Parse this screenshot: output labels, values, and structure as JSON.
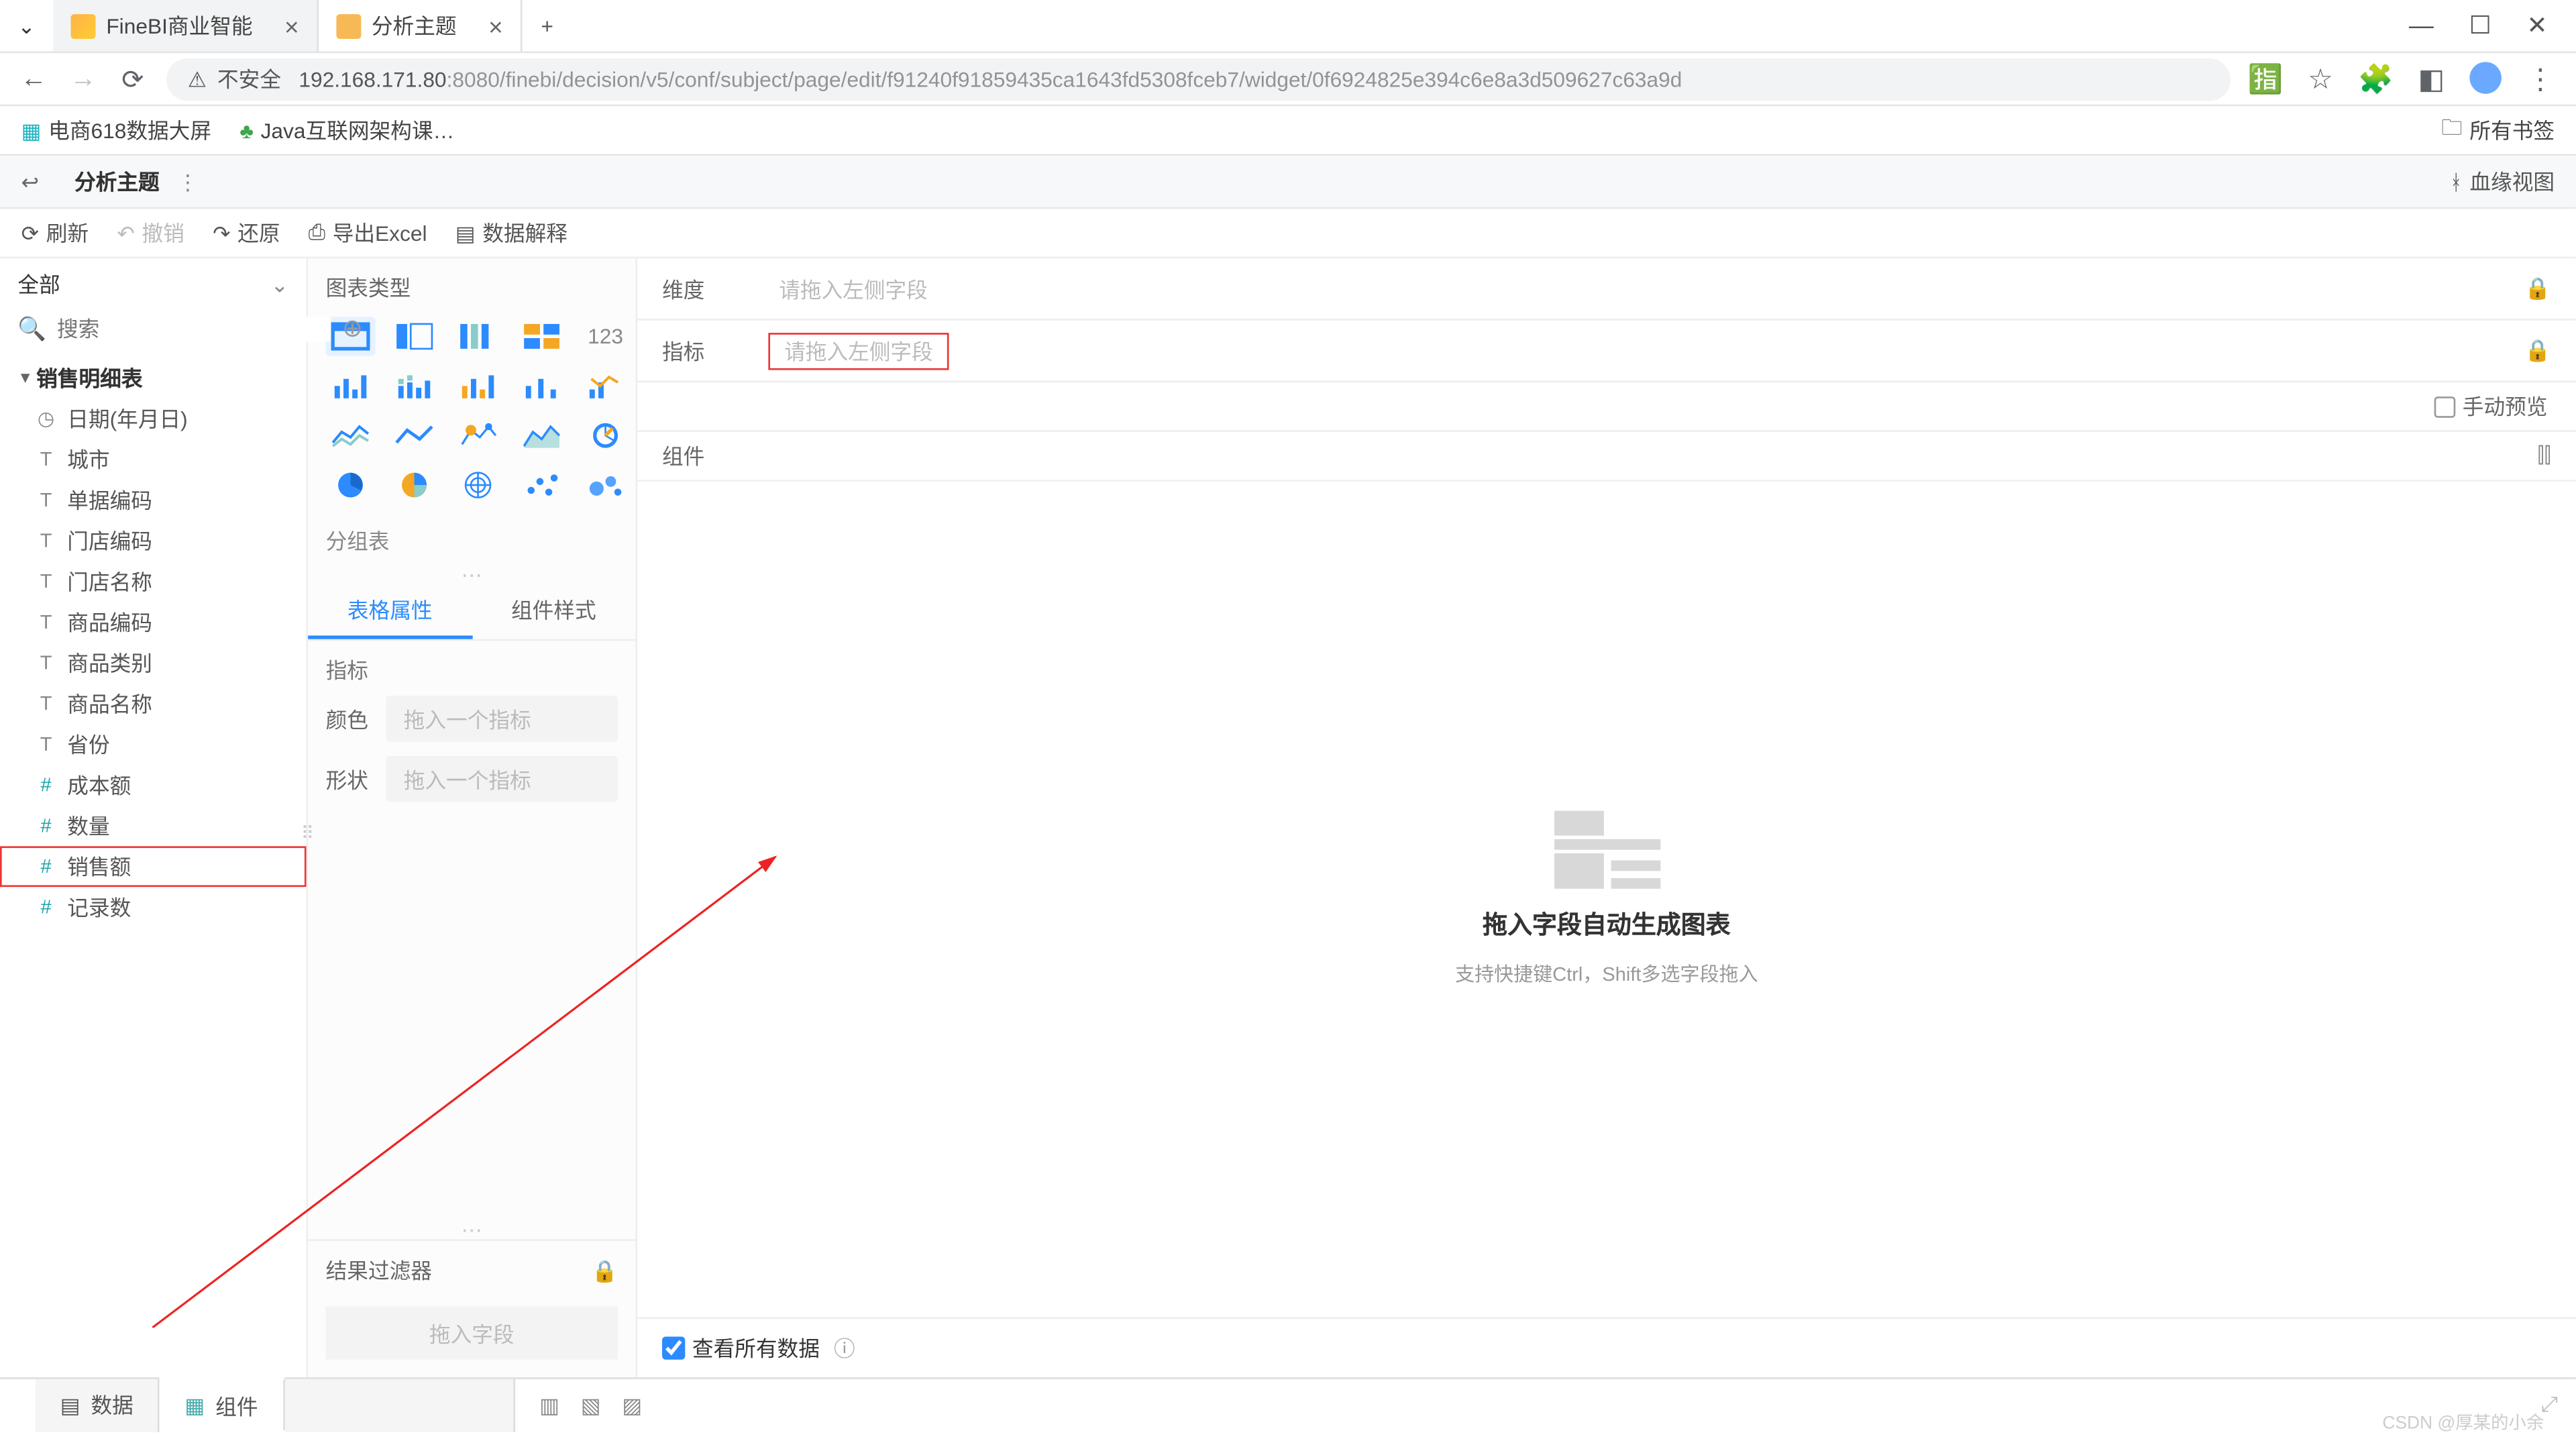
{
  "browser": {
    "tabs": [
      {
        "title": "FineBI商业智能"
      },
      {
        "title": "分析主题"
      }
    ],
    "url_prefix": "192.168.171.80",
    "url_rest": ":8080/finebi/decision/v5/conf/subject/page/edit/f91240f91859435ca1643fd5308fceb7/widget/0f6924825e394c6e8a3d509627c63a9d",
    "insecure": "不安全",
    "bookmarks": [
      {
        "label": "电商618数据大屏"
      },
      {
        "label": "Java互联网架构课…"
      }
    ],
    "all_bookmarks": "所有书签"
  },
  "appbar": {
    "title": "分析主题",
    "right": "血缘视图"
  },
  "toolbar": {
    "refresh": "刷新",
    "undo": "撤销",
    "redo": "还原",
    "export": "导出Excel",
    "explain": "数据解释"
  },
  "sidebar": {
    "all": "全部",
    "search_placeholder": "搜索",
    "group": "销售明细表",
    "fields": [
      {
        "ico": "clock",
        "name": "日期(年月日)"
      },
      {
        "ico": "text",
        "name": "城市"
      },
      {
        "ico": "text",
        "name": "单据编码"
      },
      {
        "ico": "text",
        "name": "门店编码"
      },
      {
        "ico": "text",
        "name": "门店名称"
      },
      {
        "ico": "text",
        "name": "商品编码"
      },
      {
        "ico": "text",
        "name": "商品类别"
      },
      {
        "ico": "text",
        "name": "商品名称"
      },
      {
        "ico": "text",
        "name": "省份"
      },
      {
        "ico": "hash",
        "name": "成本额"
      },
      {
        "ico": "hash",
        "name": "数量"
      },
      {
        "ico": "hash",
        "name": "销售额",
        "hi": true
      },
      {
        "ico": "hash",
        "name": "记录数"
      }
    ]
  },
  "mid": {
    "chart_type": "图表类型",
    "group_label": "分组表",
    "tab_attr": "表格属性",
    "tab_style": "组件样式",
    "metric": "指标",
    "color": "颜色",
    "shape": "形状",
    "drop_metric": "拖入一个指标",
    "filter": "结果过滤器",
    "drop_field": "拖入字段",
    "chart123": "123"
  },
  "right": {
    "dim": "维度",
    "metric": "指标",
    "drop": "请拖入左侧字段",
    "manual": "手动预览",
    "component": "组件",
    "ph_title": "拖入字段自动生成图表",
    "ph_sub": "支持快捷键Ctrl，Shift多选字段拖入",
    "view_all": "查看所有数据"
  },
  "bottom": {
    "data": "数据",
    "component": "组件"
  },
  "watermark": "CSDN @厚某的小余"
}
